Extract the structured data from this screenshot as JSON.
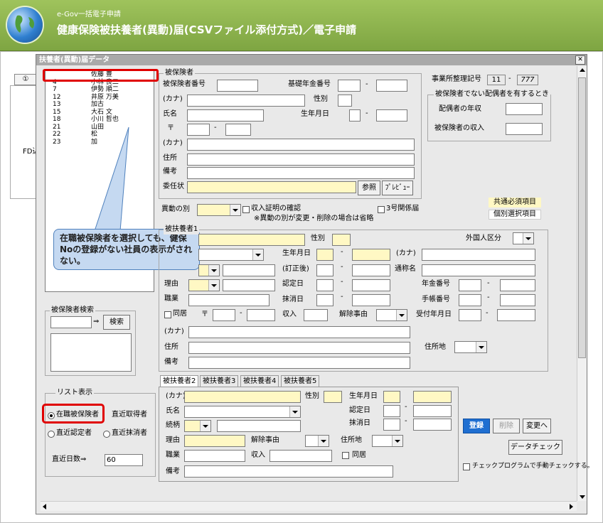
{
  "app": {
    "subtitle": "e-Gov一括電子申請",
    "title": "健康保険被扶養者(異動)届(CSVファイル添付方式)／電子申請"
  },
  "background": {
    "tab_label": "①",
    "side_text": "FD込"
  },
  "dialog": {
    "title": "扶養者(異動)届データ",
    "close_label": "✕"
  },
  "employee_list": [
    {
      "no": "",
      "name": "佐藤 豊"
    },
    {
      "no": "4",
      "name": "小林 良二"
    },
    {
      "no": "7",
      "name": "伊勢 順二"
    },
    {
      "no": "12",
      "name": "井原 万美"
    },
    {
      "no": "13",
      "name": "加古"
    },
    {
      "no": "15",
      "name": "大石 文"
    },
    {
      "no": "18",
      "name": "小川 哲也"
    },
    {
      "no": "21",
      "name": "山田"
    },
    {
      "no": "22",
      "name": "松"
    },
    {
      "no": "23",
      "name": "加"
    }
  ],
  "callout": {
    "text": "在職被保険者を選択しても、健保Noの登録がない社員の表示がされない。"
  },
  "insured": {
    "group_title": "被保険者",
    "insured_no_label": "被保険者番号",
    "pension_no_label": "基礎年金番号",
    "dash": "-",
    "kana_label": "(カナ)",
    "gender_label": "性別",
    "name_label": "氏名",
    "birth_label": "生年月日",
    "postal_mark": "〒",
    "kana2_label": "(カナ)",
    "address_label": "住所",
    "remarks_label": "備考",
    "proxy_label": "委任状",
    "browse_button": "参照",
    "preview_button": "ﾌﾟﾚﾋﾞｭｰ"
  },
  "office": {
    "label": "事業所整理記号",
    "code1": "11",
    "dash": "-",
    "code2": "777",
    "group_title": "被保険者でない配偶者を有するとき",
    "spouse_income_label": "配偶者の年収",
    "insured_income_label": "被保険者の収入"
  },
  "legend": {
    "required": "共通必須項目",
    "individual": "個別選択項目"
  },
  "change": {
    "type_label": "異動の別",
    "income_cert_label": "収入証明の確認",
    "type3_label": "3号関係届",
    "note": "※異動の別が変更・削除の場合は省略"
  },
  "dependent1": {
    "group_title": "被扶養者1",
    "gender_label": "性別",
    "foreign_label": "外国人区分",
    "birth_label": "生年月日",
    "kana_label": "(カナ)",
    "corrected_label": "(訂正後)",
    "alias_label": "通称名",
    "reason_label": "理由",
    "cert_date_label": "認定日",
    "pension_no_label": "年金番号",
    "job_label": "職業",
    "erase_date_label": "抹消日",
    "handbook_no_label": "手帳番号",
    "cohabit_label": "同居",
    "postal_mark": "〒",
    "income_label": "収入",
    "release_reason_label": "解除事由",
    "received_date_label": "受付年月日",
    "kana2_label": "(カナ)",
    "address_label": "住所",
    "residence_label": "住所地",
    "remarks_label": "備考",
    "dash": "-"
  },
  "dependent_tabs": [
    "被扶養者2",
    "被扶養者3",
    "被扶養者4",
    "被扶養者5"
  ],
  "dependent2": {
    "kana_label": "(カナ)",
    "gender_label": "性別",
    "birth_label": "生年月日",
    "name_label": "氏名",
    "cert_date_label": "認定日",
    "relation_label": "続柄",
    "erase_date_label": "抹消日",
    "reason_label": "理由",
    "release_reason_label": "解除事由",
    "residence_label": "住所地",
    "job_label": "職業",
    "income_label": "収入",
    "cohabit_label": "同居",
    "remarks_label": "備考",
    "dash": "-"
  },
  "search": {
    "group_title": "被保険者検索",
    "arrow": "⇒",
    "button": "検索"
  },
  "display": {
    "group_title": "リスト表示",
    "option_employed": "在職被保険者",
    "option_recent_acq": "直近取得者",
    "option_recent_cert": "直近認定者",
    "option_recent_erase": "直近抹消者",
    "days_label": "直近日数⇒",
    "days_value": "60"
  },
  "actions": {
    "register": "登録",
    "delete": "削除",
    "change": "変更へ",
    "data_check": "データチェック",
    "manual_check_label": "チェックプログラムで手動チェックする。"
  },
  "colors": {
    "header_green": "#8bb24c",
    "dialog_title": "#a9a9a9",
    "required_yellow": "#fff8c4",
    "highlight_red": "#e00000",
    "callout_blue": "#c5d9f1",
    "register_blue": "#1f6fd1"
  }
}
